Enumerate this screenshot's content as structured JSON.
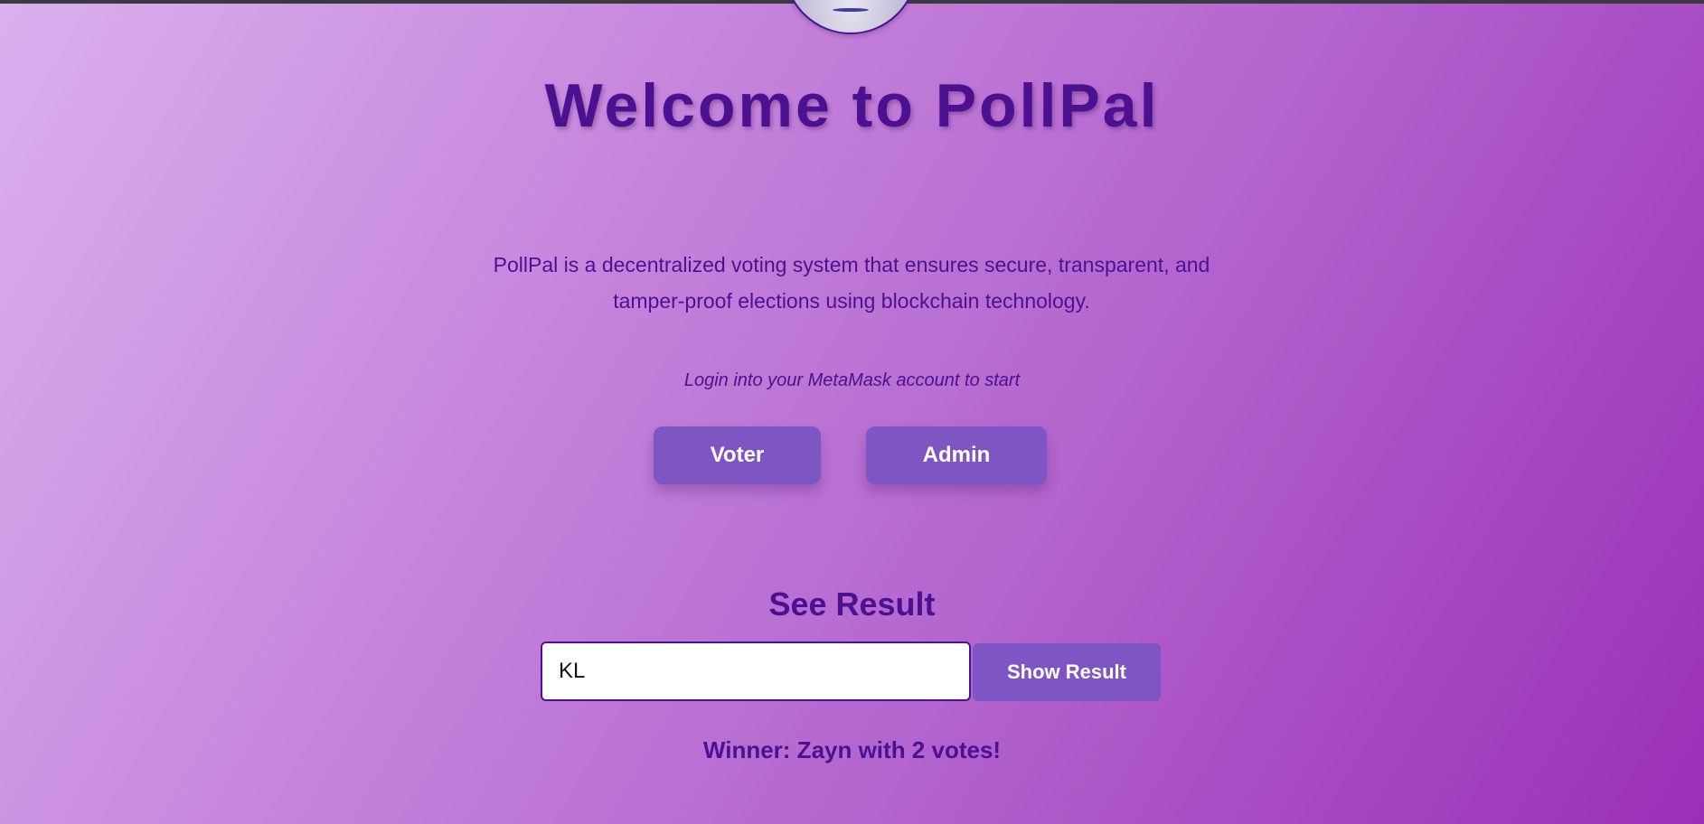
{
  "app": {
    "title": "Welcome to PollPal",
    "description": "PollPal is a decentralized voting system that ensures secure, transparent, and tamper-proof elections using blockchain technology.",
    "login_hint": "Login into your MetaMask account to start"
  },
  "logo": {
    "icon": "pollpal-logo-icon"
  },
  "roles": {
    "voter_label": "Voter",
    "admin_label": "Admin"
  },
  "results": {
    "heading": "See Result",
    "input_value": "KL",
    "button_label": "Show Result",
    "winner_text": "Winner: Zayn with 2 votes!"
  },
  "colors": {
    "accent": "#7e56c4",
    "text": "#4b1190",
    "background_start": "#dab0ee",
    "background_end": "#9b2fb6"
  }
}
